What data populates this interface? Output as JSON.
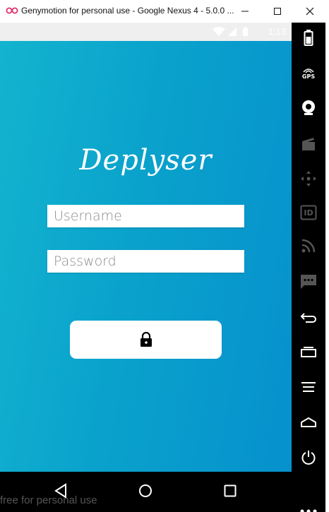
{
  "window": {
    "title": "Genymotion for personal use - Google Nexus 4 - 5.0.0 ...",
    "minimize_icon": "minimize-icon",
    "maximize_icon": "maximize-icon",
    "close_icon": "close-icon"
  },
  "statusbar": {
    "time": "1:13",
    "icons": [
      "wifi-icon",
      "signal-icon",
      "battery-icon"
    ]
  },
  "app": {
    "title": "Deplyser",
    "username_placeholder": "Username",
    "password_placeholder": "Password",
    "login_icon": "lock-icon",
    "colors": {
      "gradient_start": "#13b4cf",
      "gradient_end": "#0691cd",
      "field_bg": "#ffffff"
    }
  },
  "navbar": {
    "buttons": [
      "back-icon",
      "home-icon",
      "recent-apps-icon"
    ]
  },
  "watermark": "free for personal use",
  "toolbar": {
    "gps_label": "GPS",
    "id_label": "ID",
    "tools": [
      "battery-icon",
      "gps-icon",
      "camera-icon",
      "video-capture-icon",
      "dpad-icon",
      "id-icon",
      "rss-icon",
      "sms-icon",
      "back-icon",
      "recent-apps-icon",
      "menu-icon",
      "home-icon",
      "power-icon",
      "more-icon"
    ]
  }
}
